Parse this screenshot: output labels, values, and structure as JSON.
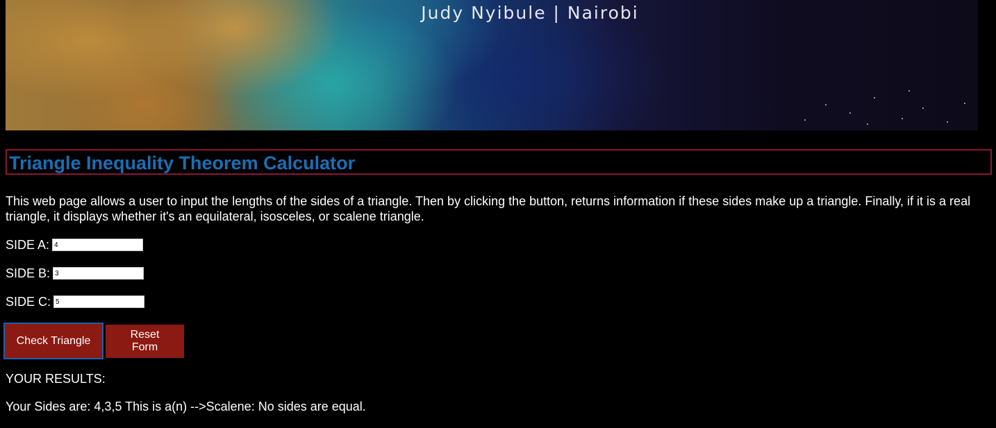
{
  "banner": {
    "caption": "Judy Nyibule | Nairobi"
  },
  "page": {
    "title": "Triangle Inequality Theorem Calculator",
    "intro": "This web page allows a user to input the lengths of the sides of a triangle. Then by clicking the button, returns information if these sides make up a triangle. Finally, if it is a real triangle, it displays whether it's an equilateral, isosceles, or scalene triangle."
  },
  "form": {
    "side_a": {
      "label": "SIDE A:",
      "value": "4"
    },
    "side_b": {
      "label": "SIDE B:",
      "value": "3"
    },
    "side_c": {
      "label": "SIDE C:",
      "value": "5"
    },
    "check_label": "Check Triangle",
    "reset_label": "Reset Form"
  },
  "results": {
    "heading": "YOUR RESULTS:",
    "text": "Your Sides are: 4,3,5 This is a(n) -->Scalene: No sides are equal."
  },
  "colors": {
    "background": "#000000",
    "title": "#1a6fb4",
    "title_border": "#8c1637",
    "button": "#8b1a12",
    "focus_outline": "#1f5fb0"
  }
}
